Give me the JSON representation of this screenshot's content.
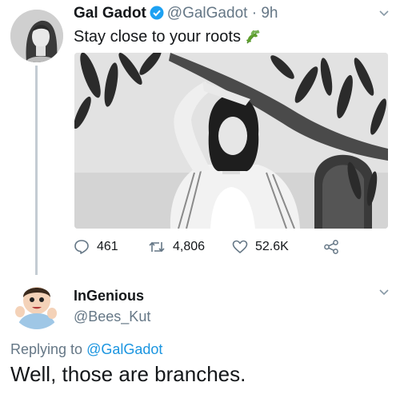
{
  "tweet": {
    "author_name": "Gal Gadot",
    "author_handle": "@GalGadot",
    "separator": "·",
    "time": "9h",
    "text": "Stay close to your roots",
    "emoji": "herb-emoji",
    "verified": true,
    "actions": {
      "replies": "461",
      "retweets": "4,806",
      "likes": "52.6K"
    }
  },
  "reply": {
    "author_name": "InGenious",
    "author_handle": "@Bees_Kut",
    "replying_prefix": "Replying to",
    "replying_to": "@GalGadot",
    "text": "Well, those are branches."
  },
  "colors": {
    "text": "#14171a",
    "secondary": "#657786",
    "link": "#1b95e0",
    "verified": "#1da1f2",
    "thread_line": "#c4ccd3"
  }
}
